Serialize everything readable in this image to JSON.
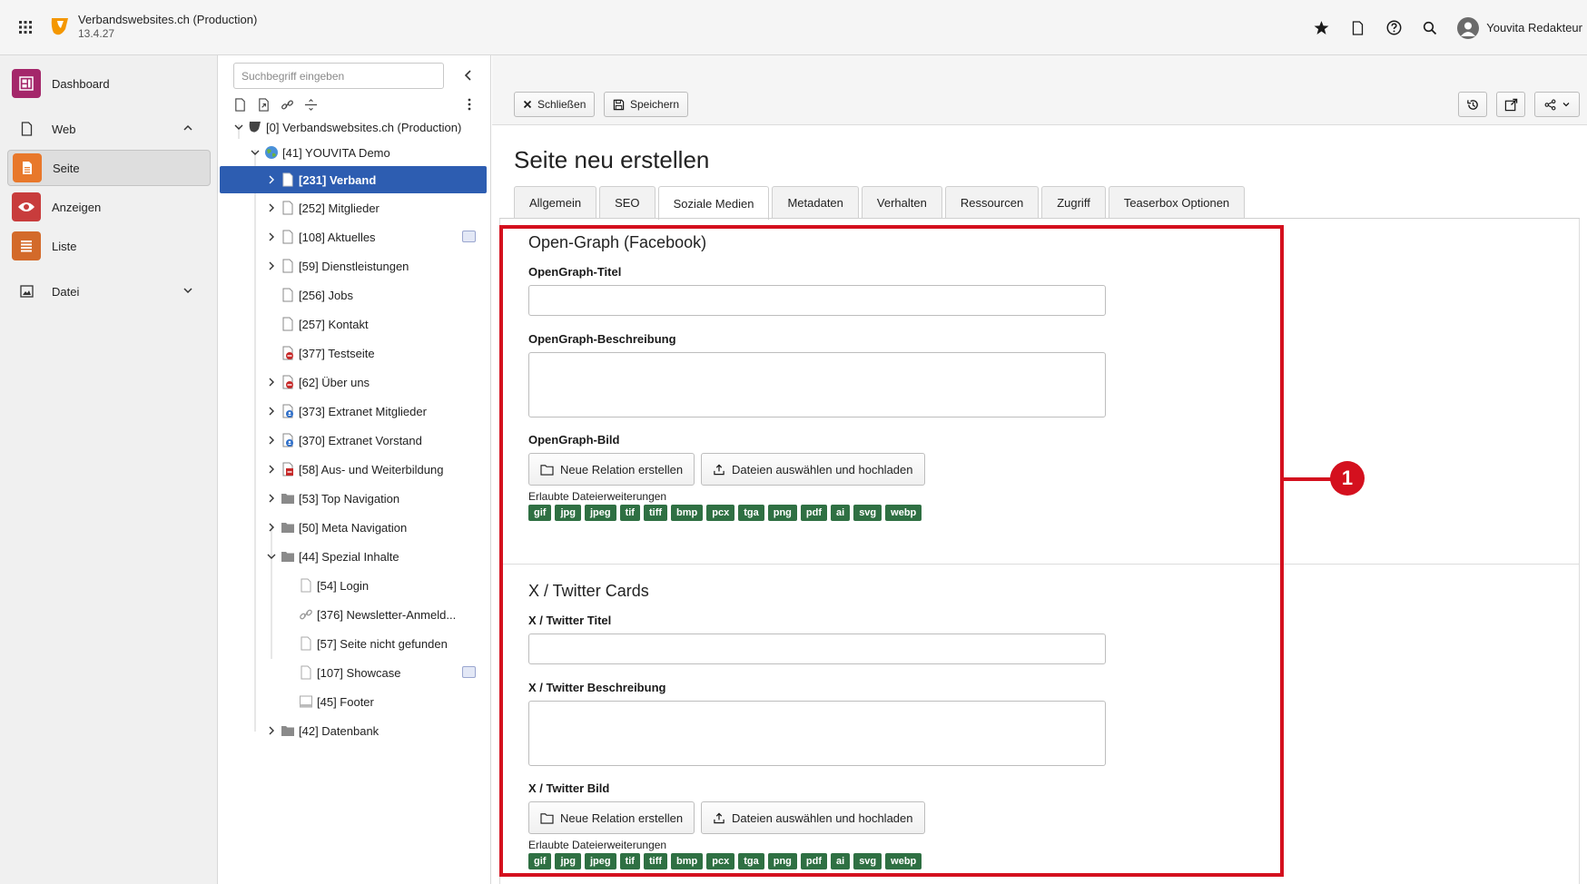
{
  "topbar": {
    "site_name": "Verbandswebsites.ch (Production)",
    "version": "13.4.27",
    "user_name": "Youvita Redakteur"
  },
  "modules": [
    {
      "label": "Dashboard",
      "icon": "dashboard-icon",
      "color": "#a4276a"
    },
    {
      "label": "Web",
      "icon": "web-page-icon",
      "color": ""
    },
    {
      "label": "Seite",
      "icon": "page-module-icon",
      "color": "#e8782b"
    },
    {
      "label": "Anzeigen",
      "icon": "eye-icon",
      "color": "#c83c3c"
    },
    {
      "label": "Liste",
      "icon": "list-icon",
      "color": "#d36a2a"
    },
    {
      "label": "Datei",
      "icon": "image-icon",
      "color": ""
    }
  ],
  "tree": {
    "search_placeholder": "Suchbegriff eingeben",
    "nodes": [
      {
        "label": "[0] Verbandswebsites.ch (Production)"
      },
      {
        "label": "[41] YOUVITA Demo"
      },
      {
        "label": "[231] Verband"
      },
      {
        "label": "[252] Mitglieder"
      },
      {
        "label": "[108] Aktuelles"
      },
      {
        "label": "[59] Dienstleistungen"
      },
      {
        "label": "[256] Jobs"
      },
      {
        "label": "[257] Kontakt"
      },
      {
        "label": "[377] Testseite"
      },
      {
        "label": "[62] Über uns"
      },
      {
        "label": "[373] Extranet Mitglieder"
      },
      {
        "label": "[370] Extranet Vorstand"
      },
      {
        "label": "[58] Aus- und Weiterbildung"
      },
      {
        "label": "[53] Top Navigation"
      },
      {
        "label": "[50] Meta Navigation"
      },
      {
        "label": "[44] Spezial Inhalte"
      },
      {
        "label": "[54] Login"
      },
      {
        "label": "[376] Newsletter-Anmeld..."
      },
      {
        "label": "[57] Seite nicht gefunden"
      },
      {
        "label": "[107] Showcase"
      },
      {
        "label": "[45] Footer"
      },
      {
        "label": "[42] Datenbank"
      }
    ]
  },
  "docheader": {
    "close_label": "Schließen",
    "save_label": "Speichern"
  },
  "main": {
    "title": "Seite neu erstellen",
    "tabs": [
      {
        "label": "Allgemein"
      },
      {
        "label": "SEO"
      },
      {
        "label": "Soziale Medien"
      },
      {
        "label": "Metadaten"
      },
      {
        "label": "Verhalten"
      },
      {
        "label": "Ressourcen"
      },
      {
        "label": "Zugriff"
      },
      {
        "label": "Teaserbox Optionen"
      }
    ],
    "og": {
      "legend": "Open-Graph (Facebook)",
      "title_label": "OpenGraph-Titel",
      "desc_label": "OpenGraph-Beschreibung",
      "image_label": "OpenGraph-Bild"
    },
    "twitter": {
      "legend": "X / Twitter Cards",
      "title_label": "X / Twitter Titel",
      "desc_label": "X / Twitter Beschreibung",
      "image_label": "X / Twitter Bild"
    },
    "btn_new_relation": "Neue Relation erstellen",
    "btn_upload": "Dateien auswählen und hochladen",
    "allowed_label": "Erlaubte Dateierweiterungen",
    "extensions": [
      "gif",
      "jpg",
      "jpeg",
      "tif",
      "tiff",
      "bmp",
      "pcx",
      "tga",
      "png",
      "pdf",
      "ai",
      "svg",
      "webp"
    ]
  },
  "annotation": {
    "number": "1",
    "color": "#d4101e"
  }
}
